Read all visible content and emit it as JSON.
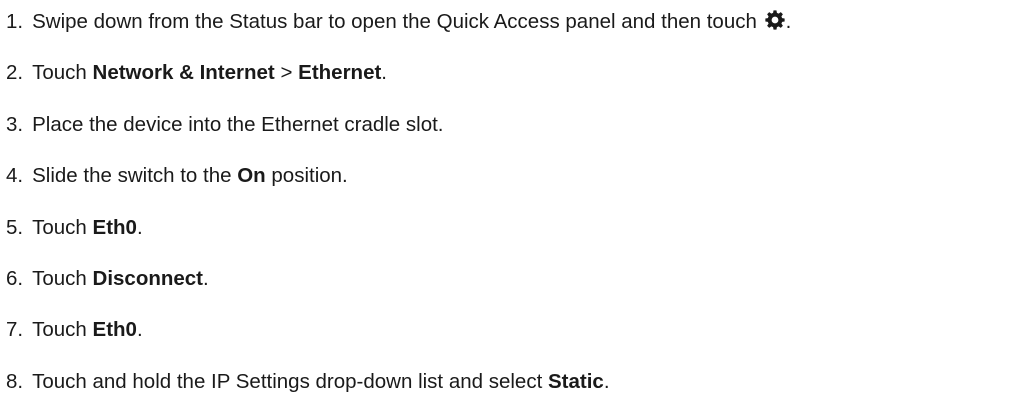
{
  "steps": [
    {
      "number": "1.",
      "text_before": "Swipe down from the Status bar to open the Quick Access panel and then touch ",
      "icon": "gear-icon",
      "text_after": "."
    },
    {
      "number": "2.",
      "text_before": "Touch ",
      "bold_1": "Network & Internet",
      "middle": " > ",
      "bold_2": "Ethernet",
      "text_after": "."
    },
    {
      "number": "3.",
      "text": "Place the device into the Ethernet cradle slot."
    },
    {
      "number": "4.",
      "text_before": "Slide the switch to the ",
      "bold": "On",
      "text_after": " position."
    },
    {
      "number": "5.",
      "text_before": "Touch ",
      "bold": "Eth0",
      "text_after": "."
    },
    {
      "number": "6.",
      "text_before": "Touch ",
      "bold": "Disconnect",
      "text_after": "."
    },
    {
      "number": "7.",
      "text_before": "Touch ",
      "bold": "Eth0",
      "text_after": "."
    },
    {
      "number": "8.",
      "text_before": "Touch and hold the IP Settings drop-down list and select ",
      "bold": "Static",
      "text_after": "."
    }
  ]
}
